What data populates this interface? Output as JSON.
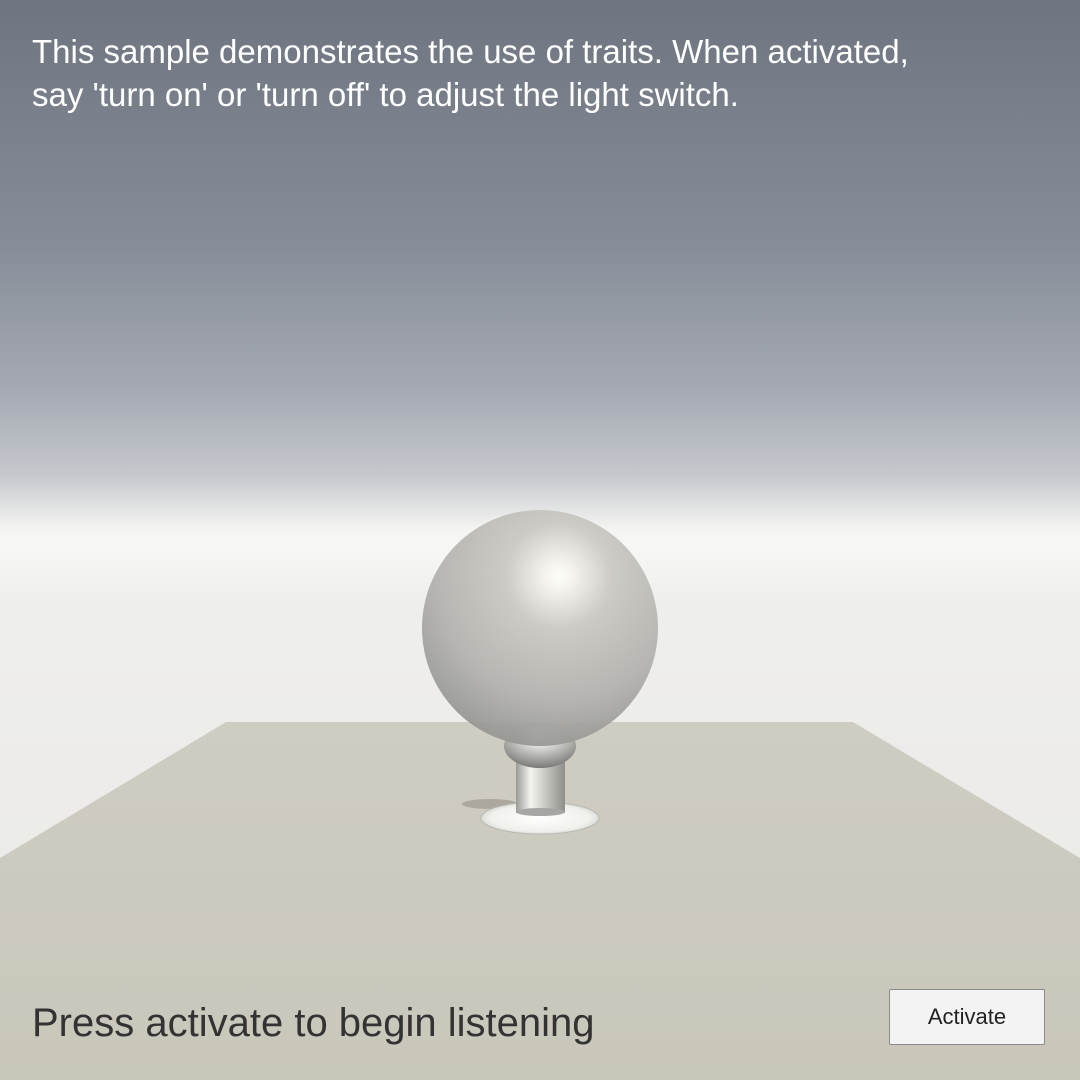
{
  "instructions": {
    "text": "This sample demonstrates the use of traits.  When activated,\nsay 'turn on' or 'turn off' to adjust the light switch."
  },
  "status": {
    "text": "Press activate to begin listening"
  },
  "buttons": {
    "activate_label": "Activate"
  },
  "colors": {
    "sky_top": "#6e7580",
    "horizon": "#f4f4f2",
    "ground": "#cbc8bc",
    "sphere": "#c6c5c0"
  }
}
